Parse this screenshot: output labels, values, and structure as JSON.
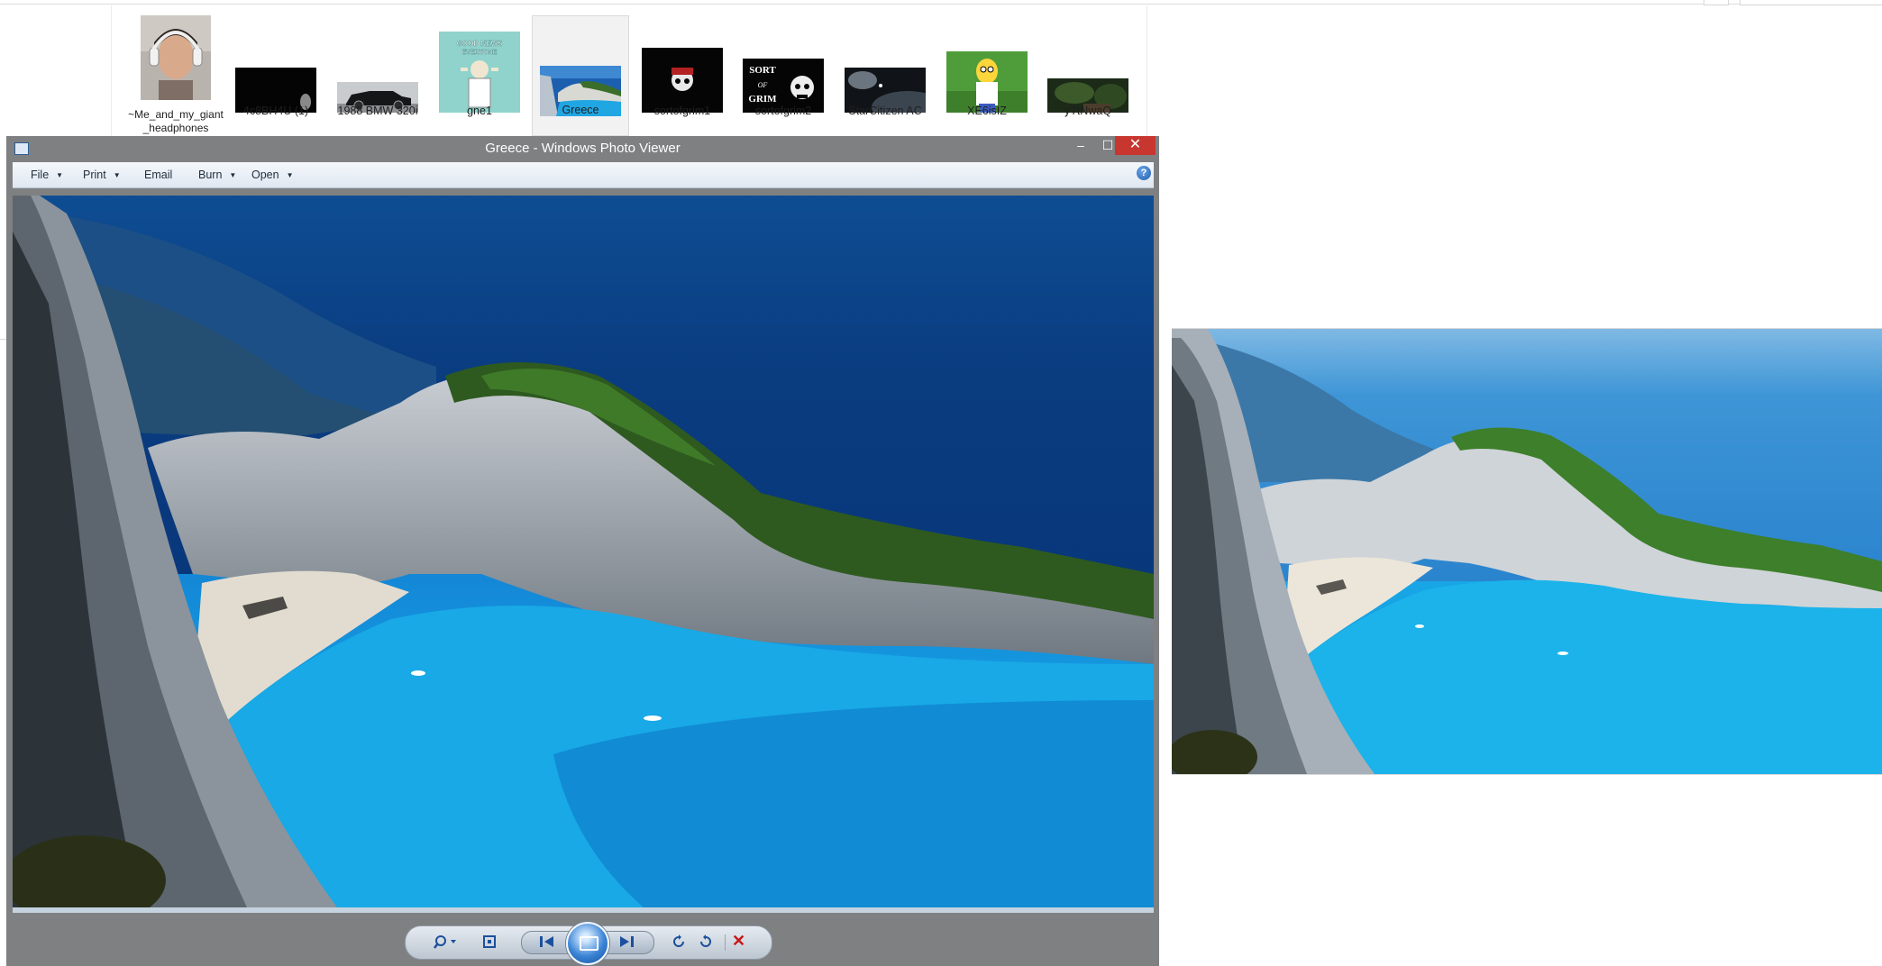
{
  "explorer": {
    "thumbnails": [
      {
        "label": "~Me_and_my_giant_headphones"
      },
      {
        "label": "4c8BH4U (1)"
      },
      {
        "label": "1988 BMW 320i"
      },
      {
        "label": "gne1",
        "caption": "GOOD NEWS EVERYONE"
      },
      {
        "label": "Greece"
      },
      {
        "label": "sortofgrim1"
      },
      {
        "label": "sortofgrim2",
        "caption": "SORT OF GRIM"
      },
      {
        "label": "StarCitizen AC"
      },
      {
        "label": "XE6isIZ"
      },
      {
        "label": "yTtNwaQ"
      }
    ],
    "selected": "Greece"
  },
  "viewer": {
    "title": "Greece - Windows Photo Viewer",
    "window_controls": {
      "minimize": "–",
      "maximize": "☐",
      "close": "✕"
    },
    "menu": [
      {
        "label": "File",
        "has_dropdown": true
      },
      {
        "label": "Print",
        "has_dropdown": true
      },
      {
        "label": "Email",
        "has_dropdown": false
      },
      {
        "label": "Burn",
        "has_dropdown": true
      },
      {
        "label": "Open",
        "has_dropdown": true
      }
    ],
    "help_label": "?",
    "toolbar": {
      "zoom_icon": "zoom-icon",
      "fit_icon": "actual-size-icon",
      "previous_icon": "previous-icon",
      "slideshow_icon": "slideshow-icon",
      "next_icon": "next-icon",
      "rotate_left_icon": "rotate-counterclockwise-icon",
      "rotate_right_icon": "rotate-clockwise-icon",
      "delete_label": "✕"
    }
  },
  "colors": {
    "window_frame": "#7f8082",
    "close_button": "#c7372f",
    "menubar": "#e6ecf3",
    "accent_blue": "#1f5fad"
  }
}
